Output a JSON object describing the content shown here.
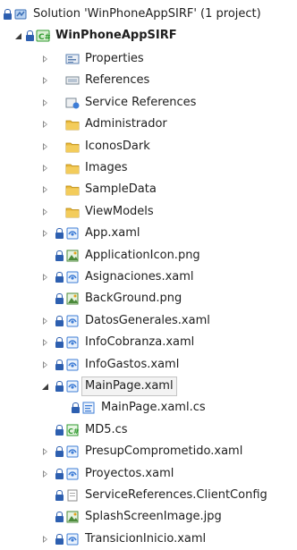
{
  "solution": {
    "label": "Solution 'WinPhoneAppSIRF' (1 project)",
    "icon": "solution-icon"
  },
  "project": {
    "label": "WinPhoneAppSIRF",
    "icon": "csharp-project-icon"
  },
  "items": [
    {
      "label": "Properties",
      "icon": "properties-icon",
      "expander": "collapsed",
      "lock": false
    },
    {
      "label": "References",
      "icon": "references-icon",
      "expander": "collapsed",
      "lock": false
    },
    {
      "label": "Service References",
      "icon": "service-references-icon",
      "expander": "collapsed",
      "lock": false
    },
    {
      "label": "Administrador",
      "icon": "folder-icon",
      "expander": "collapsed",
      "lock": false
    },
    {
      "label": "IconosDark",
      "icon": "folder-icon",
      "expander": "collapsed",
      "lock": false
    },
    {
      "label": "Images",
      "icon": "folder-icon",
      "expander": "collapsed",
      "lock": false
    },
    {
      "label": "SampleData",
      "icon": "folder-icon",
      "expander": "collapsed",
      "lock": false
    },
    {
      "label": "ViewModels",
      "icon": "folder-icon",
      "expander": "collapsed",
      "lock": false
    },
    {
      "label": "App.xaml",
      "icon": "xaml-file-icon",
      "expander": "collapsed",
      "lock": true
    },
    {
      "label": "ApplicationIcon.png",
      "icon": "image-file-icon",
      "expander": "none",
      "lock": true
    },
    {
      "label": "Asignaciones.xaml",
      "icon": "xaml-file-icon",
      "expander": "collapsed",
      "lock": true
    },
    {
      "label": "BackGround.png",
      "icon": "image-file-icon",
      "expander": "none",
      "lock": true
    },
    {
      "label": "DatosGenerales.xaml",
      "icon": "xaml-file-icon",
      "expander": "collapsed",
      "lock": true
    },
    {
      "label": "InfoCobranza.xaml",
      "icon": "xaml-file-icon",
      "expander": "collapsed",
      "lock": true
    },
    {
      "label": "InfoGastos.xaml",
      "icon": "xaml-file-icon",
      "expander": "collapsed",
      "lock": true
    },
    {
      "label": "MainPage.xaml",
      "icon": "xaml-file-icon",
      "expander": "expanded",
      "lock": true,
      "selected": true
    },
    {
      "label": "MainPage.xaml.cs",
      "icon": "csharp-code-icon",
      "expander": "none",
      "lock": true,
      "child": true
    },
    {
      "label": "MD5.cs",
      "icon": "csharp-file-icon",
      "expander": "none",
      "lock": true
    },
    {
      "label": "PresupComprometido.xaml",
      "icon": "xaml-file-icon",
      "expander": "collapsed",
      "lock": true
    },
    {
      "label": "Proyectos.xaml",
      "icon": "xaml-file-icon",
      "expander": "collapsed",
      "lock": true
    },
    {
      "label": "ServiceReferences.ClientConfig",
      "icon": "config-file-icon",
      "expander": "none",
      "lock": true
    },
    {
      "label": "SplashScreenImage.jpg",
      "icon": "image-file-icon",
      "expander": "none",
      "lock": true
    },
    {
      "label": "TransicionInicio.xaml",
      "icon": "xaml-file-icon",
      "expander": "collapsed",
      "lock": true
    }
  ],
  "colors": {
    "folder": "#e8b93c",
    "xaml": "#3e7dd6",
    "csharp": "#2f9a2f",
    "lock": "#2d5fb0"
  }
}
